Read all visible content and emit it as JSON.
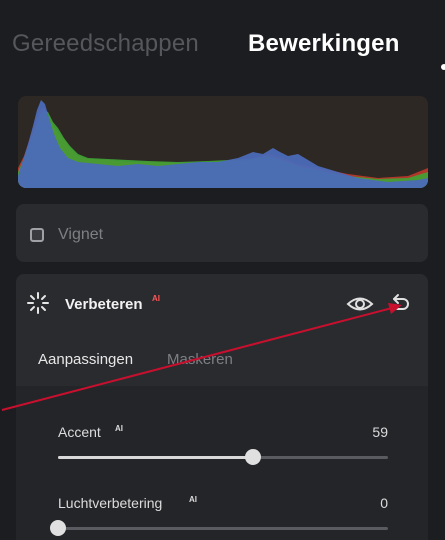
{
  "tabs": {
    "tools_label": "Gereedschappen",
    "edit_label": "Bewerkingen"
  },
  "histogram": {
    "background": "#2d2823",
    "channels": [
      "blue",
      "green",
      "red"
    ]
  },
  "vignet": {
    "label": "Vignet",
    "checked": false
  },
  "enhance": {
    "title": "Verbeteren",
    "ai_badge": "AI",
    "icons": [
      "sparkle-icon",
      "eye-icon",
      "undo-icon"
    ],
    "subtabs": {
      "adjustments": "Aanpassingen",
      "masks": "Maskeren"
    },
    "sliders": [
      {
        "label": "Accent",
        "ai_badge": "AI",
        "value": "59",
        "fraction": 0.59
      },
      {
        "label": "Luchtverbetering",
        "ai_badge": "AI",
        "value": "0",
        "fraction": 0.0
      }
    ]
  },
  "colors": {
    "accent_arrow": "#c8102e",
    "panel": "#2a2b2f",
    "background": "#1c1d20"
  }
}
